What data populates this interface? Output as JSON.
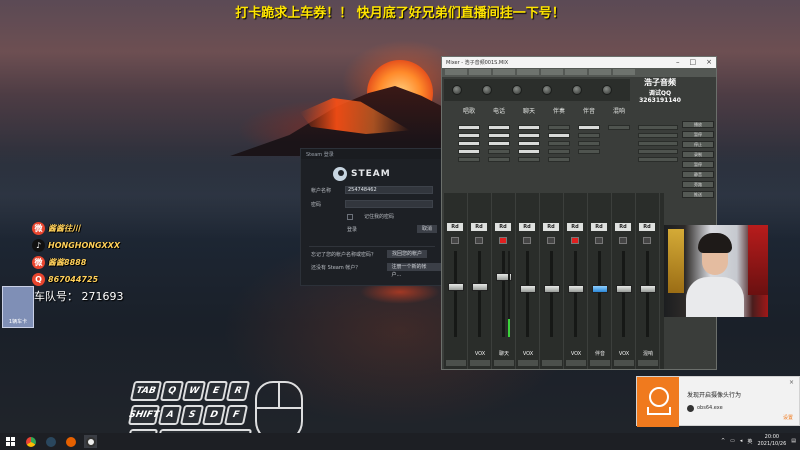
{
  "banner": {
    "text": "打卡跪求上车券！！ 快月底了好兄弟们直播间挂一下号！"
  },
  "steam": {
    "title": "Steam 登录",
    "brand": "STEAM",
    "username_label": "帐户名称",
    "username_value": "254748462",
    "password_label": "密码",
    "remember_label": "记住我的密码",
    "login_button": "登录",
    "cancel_button": "取消",
    "forgot_label": "忘记了您的帐户名称或密码？",
    "forgot_button": "找回您的帐户",
    "no_account_label": "还没有 Steam 帐户？",
    "create_button": "注册一个新的帐户..."
  },
  "chat": {
    "items": [
      {
        "name": "酱酱往川",
        "color": "#e8452e",
        "icon": "weibo-icon"
      },
      {
        "name": "HONGHONGXXX",
        "color": "#111111",
        "icon": "douyin-icon"
      },
      {
        "name": "酱酱8888",
        "color": "#e8452e",
        "icon": "weibo-icon"
      },
      {
        "name": "867044725",
        "color": "#e8452e",
        "icon": "qq-icon"
      }
    ],
    "car_tag": "1辆车卡",
    "car_label": "车队号：  271693"
  },
  "keys": [
    "TAB",
    "Q",
    "W",
    "E",
    "R",
    "SHIFT",
    "A",
    "S",
    "D",
    "F",
    "CTRL"
  ],
  "mixer": {
    "title": "Mixer - 浩子音频001S.MIX",
    "brand_line1": "浩子音频",
    "brand_line2": "调试QQ",
    "brand_line3": "3263191140",
    "channels": [
      "唱歌",
      "电话",
      "聊天",
      "伴奏",
      "伴音",
      "混响"
    ],
    "strip_labels": [
      "",
      "",
      "VOX",
      "",
      "VOX",
      "",
      "VOX",
      "",
      "VOX"
    ],
    "right_btns": [
      "播放",
      "暂停",
      "停止",
      "录制",
      "暂停",
      "静音",
      "旁路",
      "推送"
    ],
    "rd_label": "Rd"
  },
  "notification": {
    "title": "发现开启摄像头行为",
    "app": "obs64.exe",
    "action": "设置",
    "close": "×"
  },
  "taskbar": {
    "time": "20:00",
    "date": "2021/10/26",
    "ime": "英",
    "tray_up": "^"
  }
}
